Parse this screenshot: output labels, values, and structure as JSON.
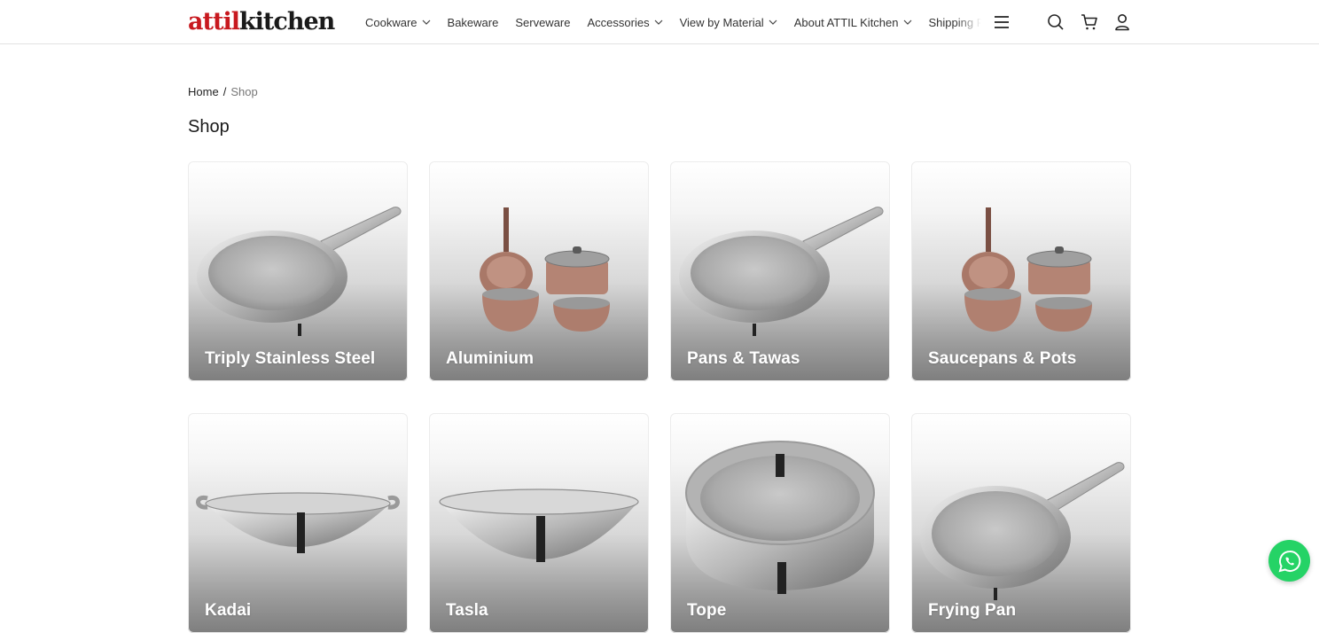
{
  "brand": {
    "logo_part1": "attil",
    "logo_part2": "kitchen",
    "accent": "#c8191f"
  },
  "nav": {
    "items": [
      {
        "label": "Cookware",
        "has_dropdown": true
      },
      {
        "label": "Bakeware",
        "has_dropdown": false
      },
      {
        "label": "Serveware",
        "has_dropdown": false
      },
      {
        "label": "Accessories",
        "has_dropdown": true
      },
      {
        "label": "View by Material",
        "has_dropdown": true
      },
      {
        "label": "About ATTIL Kitchen",
        "has_dropdown": true
      },
      {
        "label": "Shipping Policy",
        "has_dropdown": false
      }
    ],
    "icons": [
      "menu-icon",
      "search-icon",
      "cart-icon",
      "account-icon"
    ]
  },
  "breadcrumb": {
    "home": "Home",
    "separator": "/",
    "current": "Shop"
  },
  "page": {
    "title": "Shop"
  },
  "categories": [
    {
      "label": "Triply Stainless Steel",
      "image": "frying-pan-image"
    },
    {
      "label": "Aluminium",
      "image": "cookware-set-image"
    },
    {
      "label": "Pans & Tawas",
      "image": "frying-pan-image"
    },
    {
      "label": "Saucepans & Pots",
      "image": "cookware-set-image"
    },
    {
      "label": "Kadai",
      "image": "kadai-image"
    },
    {
      "label": "Tasla",
      "image": "tasla-image"
    },
    {
      "label": "Tope",
      "image": "tope-image"
    },
    {
      "label": "Frying Pan",
      "image": "frying-pan-image"
    }
  ],
  "floating": {
    "icon": "whatsapp-icon",
    "color": "#25d366"
  }
}
